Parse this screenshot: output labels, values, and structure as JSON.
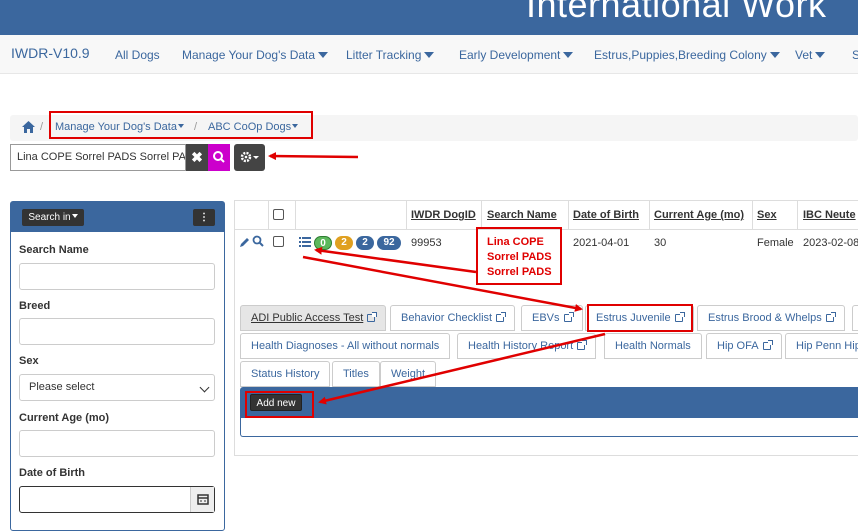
{
  "banner": {
    "title": "International Work"
  },
  "nav": {
    "brand": "IWDR-V10.9",
    "items": [
      {
        "label": "All Dogs"
      },
      {
        "label": "Manage Your Dog's Data"
      },
      {
        "label": "Litter Tracking"
      },
      {
        "label": "Early Development"
      },
      {
        "label": "Estrus,Puppies,Breeding Colony"
      },
      {
        "label": "Vet"
      },
      {
        "label": "S"
      }
    ]
  },
  "breadcrumb": {
    "items": [
      {
        "label": "Manage Your Dog's Data"
      },
      {
        "label": "ABC CoOp Dogs"
      }
    ],
    "separator": "/"
  },
  "search": {
    "value": "Lina COPE Sorrel PADS Sorrel PADS",
    "clear_icon": "close-icon",
    "search_icon": "search-icon",
    "settings_icon": "gear-icon"
  },
  "sidebar": {
    "search_in_label": "Search in",
    "fields": {
      "search_name": "Search Name",
      "breed": "Breed",
      "sex": "Sex",
      "sex_selected": "Please select",
      "current_age": "Current Age (mo)",
      "dob": "Date of Birth"
    }
  },
  "table": {
    "headers": [
      "IWDR DogID",
      "Search Name",
      "Date of Birth",
      "Current Age (mo)",
      "Sex",
      "IBC Neute"
    ],
    "row": {
      "dog_id": "99953",
      "search_name_lines": [
        "Lina COPE",
        "Sorrel PADS",
        "Sorrel PADS"
      ],
      "dob": "2021-04-01",
      "age": "30",
      "sex": "Female",
      "ibc": "2023-02-08",
      "badges": [
        "0",
        "2",
        "2",
        "92"
      ]
    }
  },
  "tabs": {
    "row1": [
      "ADI Public Access Test",
      "Behavior Checklist",
      "EBVs",
      "Estrus Juvenile",
      "Estrus Brood & Whelps"
    ],
    "row2": [
      "Health Diagnoses - All without normals",
      "Health History Report",
      "Health Normals",
      "Hip OFA",
      "Hip Penn Hip"
    ],
    "row3": [
      "Status History",
      "Titles",
      "Weight"
    ]
  },
  "subpanel": {
    "add_new": "Add new"
  },
  "colors": {
    "brand": "#3b679e",
    "highlight": "#e00000",
    "badge_green": "#5cb85c",
    "badge_orange": "#e0a020",
    "badge_blue": "#3b679e"
  }
}
